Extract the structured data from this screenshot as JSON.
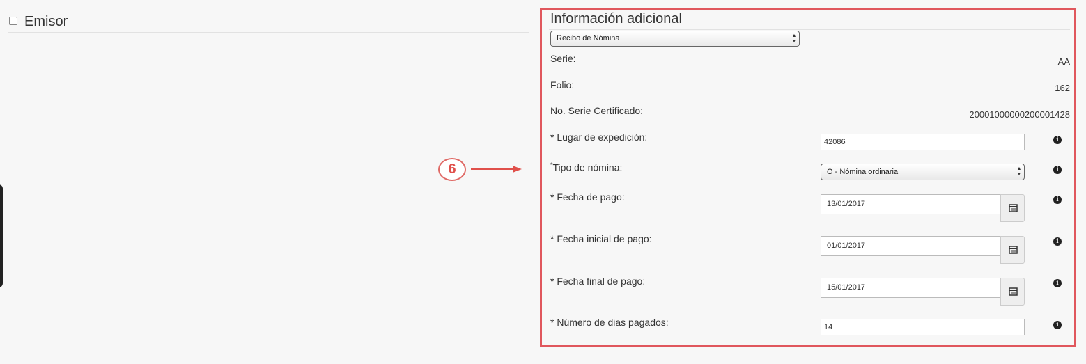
{
  "emisor": {
    "title": "Emisor"
  },
  "callout": {
    "number": "6"
  },
  "panel": {
    "title": "Información adicional",
    "doc_type_select": "Recibo de Nómina",
    "serie": {
      "label": "Serie:",
      "value": "AA"
    },
    "folio": {
      "label": "Folio:",
      "value": "162"
    },
    "no_serie": {
      "label": "No. Serie Certificado:",
      "value": "20001000000200001428"
    },
    "lugar": {
      "label": "* Lugar de expedición:",
      "value": "42086"
    },
    "tipo_nomina": {
      "asterisk": "*",
      "label": "Tipo de nómina:",
      "value": "O - Nómina ordinaria"
    },
    "fecha_pago": {
      "label": "* Fecha de pago:",
      "value": "13/01/2017"
    },
    "fecha_inicial": {
      "label": "* Fecha inicial de pago:",
      "value": "01/01/2017"
    },
    "fecha_final": {
      "label": "* Fecha final de pago:",
      "value": "15/01/2017"
    },
    "dias_pagados": {
      "label": "* Número de dias pagados:",
      "value": "14"
    }
  },
  "colors": {
    "frame": "#e0575d",
    "callout": "#e0504b"
  },
  "icons": {
    "info": "info-icon",
    "calendar": "calendar-icon",
    "arrow": "arrow-right-icon"
  }
}
